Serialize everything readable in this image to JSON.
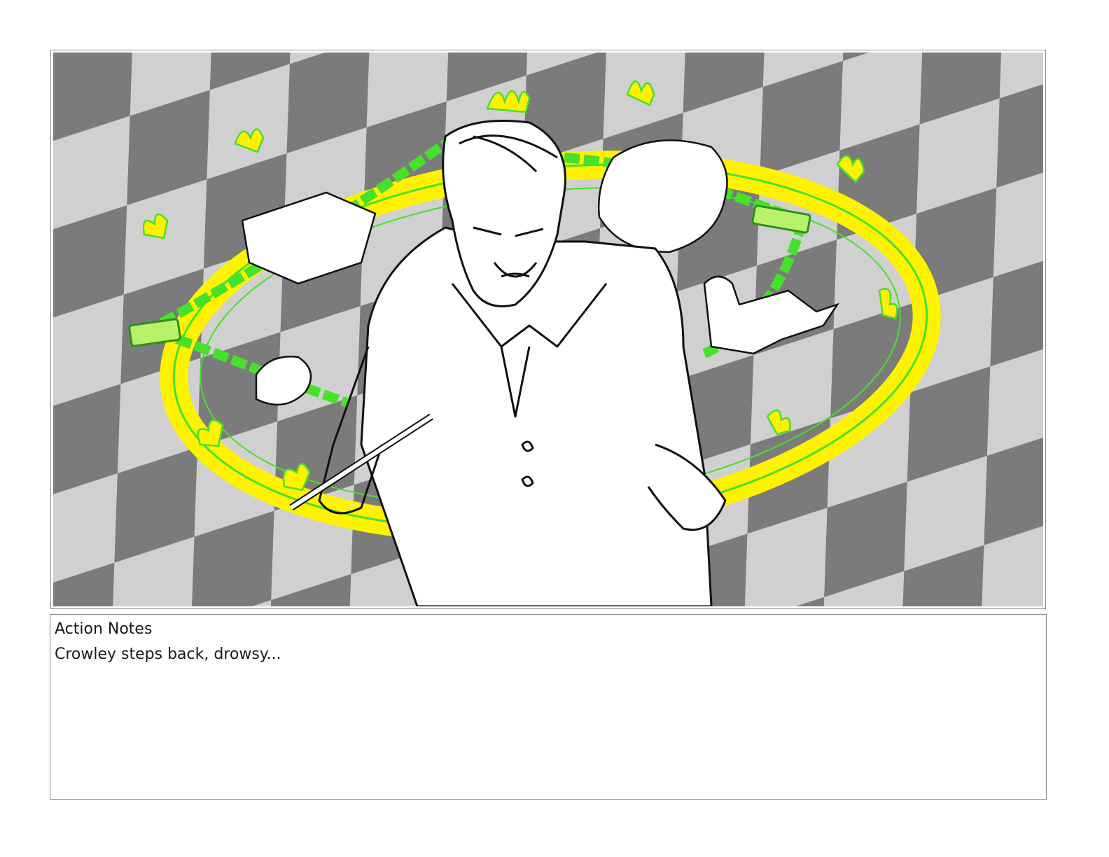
{
  "storyboard": {
    "panel": {
      "image_description_name": "storyboard-sketch",
      "colors": {
        "fire_fill": "#fff200",
        "fire_outline": "#47e02b",
        "floor_light": "#d6d6d6",
        "floor_dark": "#7d7d7d",
        "ink": "#111111"
      }
    },
    "notes": {
      "heading": "Action Notes",
      "text": "Crowley steps back, drowsy..."
    }
  }
}
